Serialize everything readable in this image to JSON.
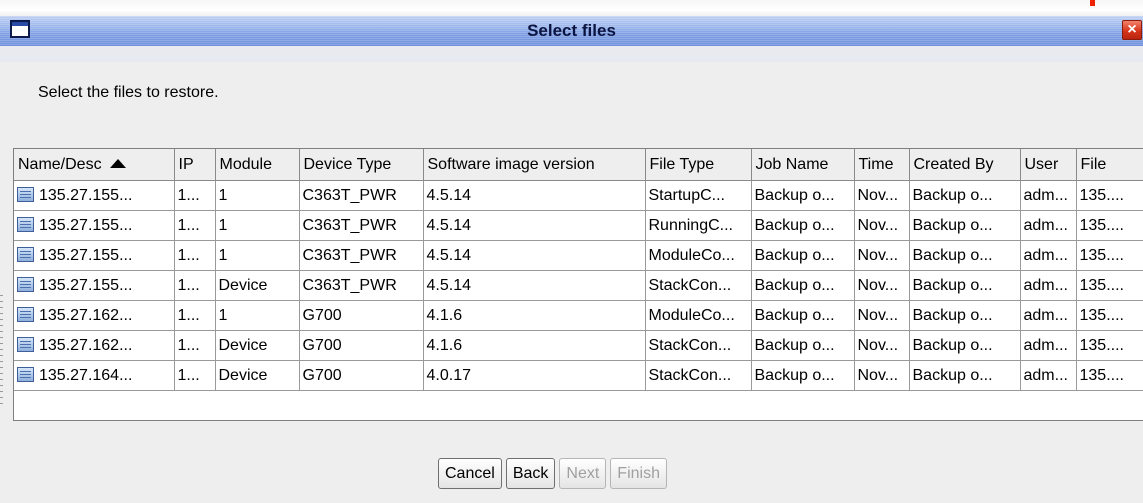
{
  "window": {
    "title": "Select files",
    "close_label": "×"
  },
  "instruction": "Select the files to restore.",
  "table": {
    "columns": [
      "Name/Desc",
      "IP",
      "Module",
      "Device Type",
      "Software image version",
      "File Type",
      "Job Name",
      "Time",
      "Created By",
      "User",
      "File"
    ],
    "sorted_column": "Name/Desc",
    "rows": [
      [
        "135.27.155...",
        "1...",
        "1",
        "C363T_PWR",
        "4.5.14",
        "StartupC...",
        "Backup o...",
        "Nov...",
        "Backup o...",
        "adm...",
        "135...."
      ],
      [
        "135.27.155...",
        "1...",
        "1",
        "C363T_PWR",
        "4.5.14",
        "RunningC...",
        "Backup o...",
        "Nov...",
        "Backup o...",
        "adm...",
        "135...."
      ],
      [
        "135.27.155...",
        "1...",
        "1",
        "C363T_PWR",
        "4.5.14",
        "ModuleCo...",
        "Backup o...",
        "Nov...",
        "Backup o...",
        "adm...",
        "135...."
      ],
      [
        "135.27.155...",
        "1...",
        "Device",
        "C363T_PWR",
        "4.5.14",
        "StackCon...",
        "Backup o...",
        "Nov...",
        "Backup o...",
        "adm...",
        "135...."
      ],
      [
        "135.27.162...",
        "1...",
        "1",
        "G700",
        "4.1.6",
        "ModuleCo...",
        "Backup o...",
        "Nov...",
        "Backup o...",
        "adm...",
        "135...."
      ],
      [
        "135.27.162...",
        "1...",
        "Device",
        "G700",
        "4.1.6",
        "StackCon...",
        "Backup o...",
        "Nov...",
        "Backup o...",
        "adm...",
        "135...."
      ],
      [
        "135.27.164...",
        "1...",
        "Device",
        "G700",
        "4.0.17",
        "StackCon...",
        "Backup o...",
        "Nov...",
        "Backup o...",
        "adm...",
        "135...."
      ]
    ],
    "row_icon": "file-icon"
  },
  "buttons": {
    "cancel": "Cancel",
    "back": "Back",
    "next": "Next",
    "finish": "Finish"
  },
  "colors": {
    "titlebar": "#7f9fe3",
    "close": "#d6361a",
    "background": "#eeeeee"
  }
}
